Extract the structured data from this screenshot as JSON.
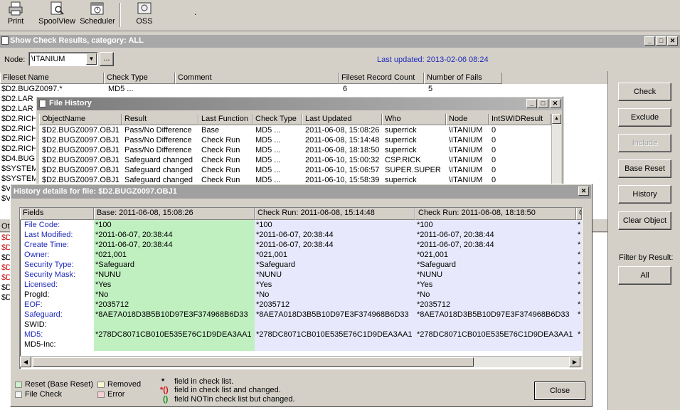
{
  "toolbar": {
    "print": "Print",
    "spoolview": "SpoolView",
    "scheduler": "Scheduler",
    "oss": "OSS",
    "dot": "."
  },
  "main_window": {
    "title": "Show Check Results, category: ALL",
    "node_label": "Node:",
    "node_value": "\\ITANIUM",
    "node_button": "...",
    "last_updated": "Last updated: 2013-02-06 08:24",
    "columns": [
      "Fileset Name",
      "Check Type",
      "Comment",
      "Fileset Record Count",
      "Number of Fails"
    ],
    "first_row": {
      "fileset": "$D2.BUGZ0097.*",
      "type": "MD5 ...",
      "comment": "",
      "count": "6",
      "fails": "5"
    },
    "left_rows": [
      "$D2.LAR",
      "$D2.LAR",
      "$D2.RICH",
      "$D2.RICH",
      "$D2.RICH",
      "$D2.RICH",
      "$D4.BUG",
      "$SYSTEM",
      "$SYSTEM",
      "$V",
      "$V"
    ],
    "lower_label": "Ot",
    "lower_rows": [
      "$D",
      "$D",
      "$D",
      "$D",
      "$D",
      "$D",
      "$D"
    ]
  },
  "right_buttons": {
    "check": "Check",
    "exclude": "Exclude",
    "include": "Include",
    "base_reset": "Base Reset",
    "history": "History",
    "clear_object": "Clear Object",
    "filter_label": "Filter by Result:",
    "all": "All"
  },
  "file_history": {
    "title": "File History",
    "columns": [
      "ObjectName",
      "Result",
      "Last Function",
      "Check Type",
      "Last Updated",
      "Who",
      "Node",
      "IntSWIDResult"
    ],
    "rows": [
      [
        "$D2.BUGZ0097.OBJ1",
        "Pass/No Difference",
        "Base",
        "MD5 ...",
        "2011-06-08, 15:08:26",
        "superrick",
        "\\ITANIUM",
        "0"
      ],
      [
        "$D2.BUGZ0097.OBJ1",
        "Pass/No Difference",
        "Check Run",
        "MD5 ...",
        "2011-06-08, 15:14:48",
        "superrick",
        "\\ITANIUM",
        "0"
      ],
      [
        "$D2.BUGZ0097.OBJ1",
        "Pass/No Difference",
        "Check Run",
        "MD5 ...",
        "2011-06-08, 18:18:50",
        "superrick",
        "\\ITANIUM",
        "0"
      ],
      [
        "$D2.BUGZ0097.OBJ1",
        "Safeguard changed",
        "Check Run",
        "MD5 ...",
        "2011-06-10, 15:00:32",
        "CSP.RICK",
        "\\ITANIUM",
        "0"
      ],
      [
        "$D2.BUGZ0097.OBJ1",
        "Safeguard changed",
        "Check Run",
        "MD5 ...",
        "2011-06-10, 15:06:57",
        "SUPER.SUPER",
        "\\ITANIUM",
        "0"
      ],
      [
        "$D2.BUGZ0097.OBJ1",
        "Safeguard changed",
        "Check Run",
        "MD5 ...",
        "2011-06-10, 15:58:39",
        "superrick",
        "\\ITANIUM",
        "0"
      ]
    ]
  },
  "history_details": {
    "title": "History details for file: $D2.BUGZ0097.OBJ1",
    "columns": [
      "Fields",
      "Base: 2011-06-08, 15:08:26",
      "Check Run: 2011-06-08, 15:14:48",
      "Check Run: 2011-06-08, 18:18:50",
      "C"
    ],
    "fields": [
      {
        "name": "File Code:",
        "blue": true,
        "base": "*100",
        "run1": "*100",
        "run2": "*100",
        "edge": "*"
      },
      {
        "name": "Last Modified:",
        "blue": true,
        "base": "*2011-06-07, 20:38:44",
        "run1": "*2011-06-07, 20:38:44",
        "run2": "*2011-06-07, 20:38:44",
        "edge": "*"
      },
      {
        "name": "Create Time:",
        "blue": true,
        "base": "*2011-06-07, 20:38:44",
        "run1": "*2011-06-07, 20:38:44",
        "run2": "*2011-06-07, 20:38:44",
        "edge": "*"
      },
      {
        "name": "Owner:",
        "blue": true,
        "base": "*021,001",
        "run1": "*021,001",
        "run2": "*021,001",
        "edge": "*"
      },
      {
        "name": "Security Type:",
        "blue": true,
        "base": "*Safeguard",
        "run1": "*Safeguard",
        "run2": "*Safeguard",
        "edge": "*"
      },
      {
        "name": "Security Mask:",
        "blue": true,
        "base": "*NUNU",
        "run1": "*NUNU",
        "run2": "*NUNU",
        "edge": "*"
      },
      {
        "name": "Licensed:",
        "blue": true,
        "base": "*Yes",
        "run1": "*Yes",
        "run2": "*Yes",
        "edge": "*"
      },
      {
        "name": "ProgId:",
        "blue": false,
        "base": "*No",
        "run1": "*No",
        "run2": "*No",
        "edge": "*"
      },
      {
        "name": "EOF:",
        "blue": true,
        "base": "*2035712",
        "run1": "*2035712",
        "run2": "*2035712",
        "edge": "*"
      },
      {
        "name": "Safeguard:",
        "blue": true,
        "base": "*8AE7A018D3B5B10D97E3F374968B6D33",
        "run1": "*8AE7A018D3B5B10D97E3F374968B6D33",
        "run2": "*8AE7A018D3B5B10D97E3F374968B6D33",
        "edge": "*"
      },
      {
        "name": "SWID:",
        "blue": false,
        "base": "",
        "run1": "",
        "run2": "",
        "edge": ""
      },
      {
        "name": "MD5:",
        "blue": true,
        "base": "*278DC8071CB010E535E76C1D9DEA3AA1",
        "run1": "*278DC8071CB010E535E76C1D9DEA3AA1",
        "run2": "*278DC8071CB010E535E76C1D9DEA3AA1",
        "edge": "*"
      },
      {
        "name": "MD5-Inc:",
        "blue": false,
        "base": "",
        "run1": "",
        "run2": "",
        "edge": ""
      }
    ],
    "legend": {
      "reset": "Reset (Base Reset)",
      "file_check": "File Check",
      "removed": "Removed",
      "error": "Error",
      "star1": "*",
      "star1_text": "field in check list.",
      "star2": "*()",
      "star2_text": "field in check list and changed.",
      "paren": "()",
      "paren_text": "field NOTin check list but changed."
    },
    "close": "Close"
  },
  "colors": {
    "base_col": "#c0f0c0",
    "run_col": "#e8e8fc",
    "field_blue": "#1f2bb8",
    "legend_green": "#d0f0d0",
    "legend_yellow": "#fff8d0",
    "legend_pink": "#f8d0d0"
  }
}
